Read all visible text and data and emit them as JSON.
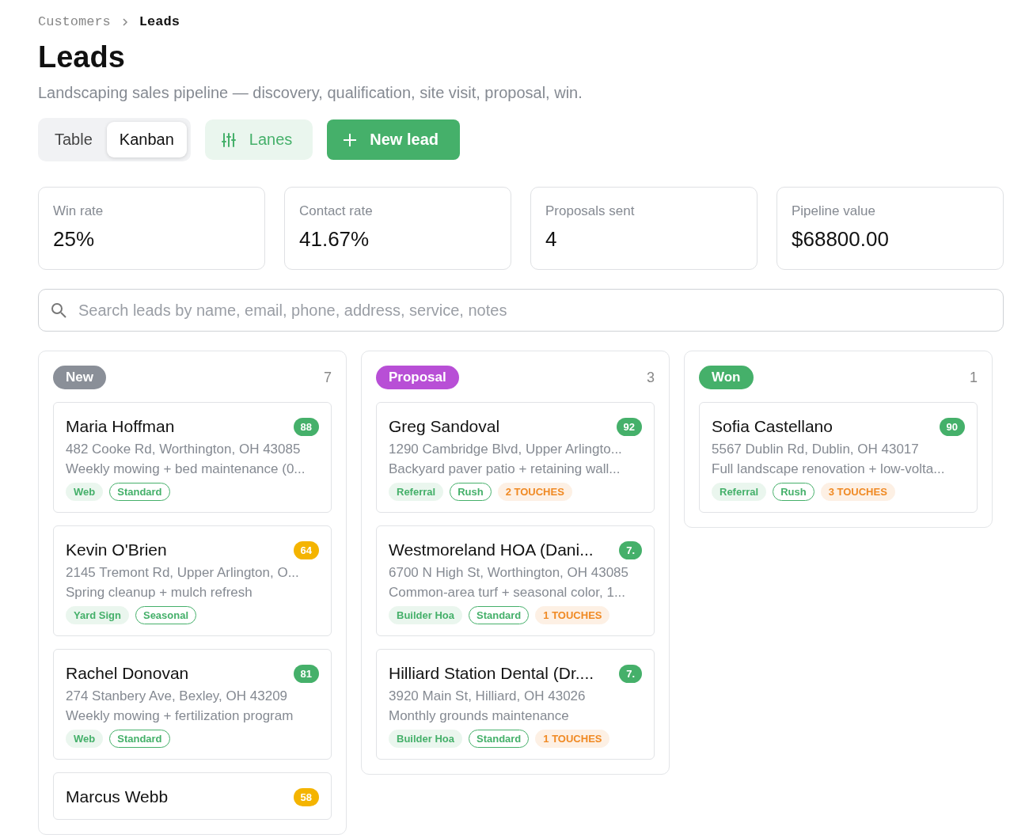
{
  "breadcrumb": [
    {
      "label": "Customers",
      "current": false
    },
    {
      "label": "Leads",
      "current": true
    }
  ],
  "title": "Leads",
  "subtitle": "Landscaping sales pipeline — discovery, qualification, site visit, proposal, win.",
  "view_toggle": [
    {
      "label": "Table",
      "selected": false
    },
    {
      "label": "Kanban",
      "selected": true
    }
  ],
  "lanes_button": "Lanes",
  "new_button": "New lead",
  "stats": [
    {
      "label": "Win rate",
      "value": "25%"
    },
    {
      "label": "Contact rate",
      "value": "41.67%"
    },
    {
      "label": "Proposals sent",
      "value": "4"
    },
    {
      "label": "Pipeline value",
      "value": "$68800.00"
    }
  ],
  "search": {
    "placeholder": "Search leads by name, email, phone, address, service, notes"
  },
  "lanes": [
    {
      "name": "New",
      "color": "#8a8f98",
      "count": "7",
      "cards": [
        {
          "name": "Maria Hoffman",
          "score": "88",
          "color": "#45b06a",
          "address": "482 Cooke Rd, Worthington, OH 43085",
          "service": "Weekly mowing + bed maintenance (0...",
          "tags": [
            {
              "kind": "source",
              "label": "Web"
            },
            {
              "kind": "priority",
              "label": "Standard"
            }
          ]
        },
        {
          "name": "Kevin O'Brien",
          "score": "64",
          "color": "#f4b400",
          "address": "2145 Tremont Rd, Upper Arlington, O...",
          "service": "Spring cleanup + mulch refresh",
          "tags": [
            {
              "kind": "source",
              "label": "Yard Sign"
            },
            {
              "kind": "priority",
              "label": "Seasonal"
            }
          ]
        },
        {
          "name": "Rachel Donovan",
          "score": "81",
          "color": "#45b06a",
          "address": "274 Stanbery Ave, Bexley, OH 43209",
          "service": "Weekly mowing + fertilization program",
          "tags": [
            {
              "kind": "source",
              "label": "Web"
            },
            {
              "kind": "priority",
              "label": "Standard"
            }
          ]
        },
        {
          "name": "Marcus Webb",
          "score": "58",
          "color": "#f4b400"
        }
      ]
    },
    {
      "name": "Proposal",
      "color": "#b84fd6",
      "count": "3",
      "cards": [
        {
          "name": "Greg Sandoval",
          "score": "92",
          "color": "#45b06a",
          "address": "1290 Cambridge Blvd, Upper Arlingto...",
          "service": "Backyard paver patio + retaining wall...",
          "tags": [
            {
              "kind": "source",
              "label": "Referral"
            },
            {
              "kind": "priority",
              "label": "Rush"
            },
            {
              "kind": "touches",
              "label": "2 TOUCHES"
            }
          ]
        },
        {
          "name": "Westmoreland HOA (Dani...",
          "score": "7.",
          "color": "#45b06a",
          "address": "6700 N High St, Worthington, OH 43085",
          "service": "Common-area turf + seasonal color, 1...",
          "tags": [
            {
              "kind": "source",
              "label": "Builder Hoa"
            },
            {
              "kind": "priority",
              "label": "Standard"
            },
            {
              "kind": "touches",
              "label": "1 TOUCHES"
            }
          ]
        },
        {
          "name": "Hilliard Station Dental (Dr....",
          "score": "7.",
          "color": "#45b06a",
          "address": "3920 Main St, Hilliard, OH 43026",
          "service": "Monthly grounds maintenance",
          "tags": [
            {
              "kind": "source",
              "label": "Builder Hoa"
            },
            {
              "kind": "priority",
              "label": "Standard"
            },
            {
              "kind": "touches",
              "label": "1 TOUCHES"
            }
          ]
        }
      ]
    },
    {
      "name": "Won",
      "color": "#45b06a",
      "count": "1",
      "cards": [
        {
          "name": "Sofia Castellano",
          "score": "90",
          "color": "#45b06a",
          "address": "5567 Dublin Rd, Dublin, OH 43017",
          "service": "Full landscape renovation + low-volta...",
          "tags": [
            {
              "kind": "source",
              "label": "Referral"
            },
            {
              "kind": "priority",
              "label": "Rush"
            },
            {
              "kind": "touches",
              "label": "3 TOUCHES"
            }
          ]
        }
      ]
    }
  ]
}
